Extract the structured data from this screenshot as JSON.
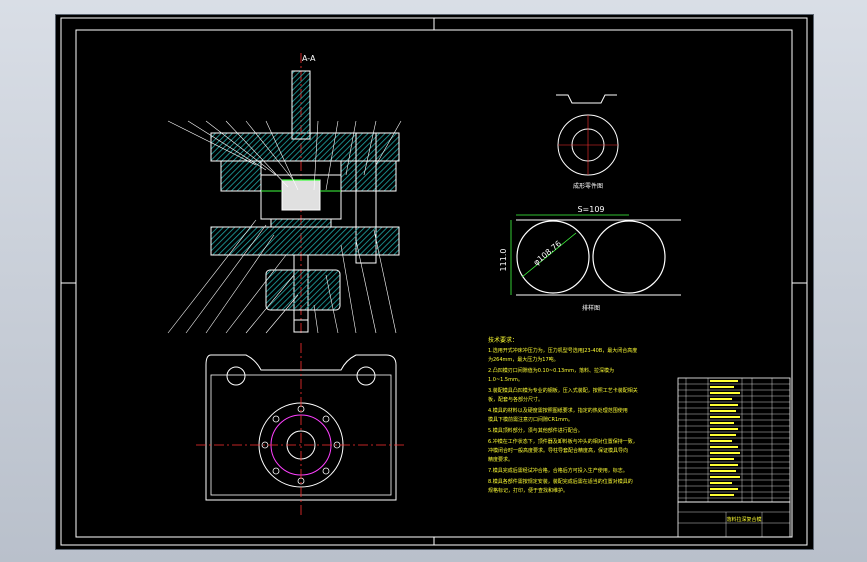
{
  "section_label": "A-A",
  "blank_view": {
    "caption": "成形零件图"
  },
  "strip_layout": {
    "pitch_label": "S=109",
    "width_label": "111.0",
    "diameter_label": "φ108.76",
    "caption": "排样图"
  },
  "technical_requirements": {
    "title": "技术要求：",
    "lines": [
      "1.选用开式冲床冲压力为，压力机型号选用J23-40B，最大闭合高度",
      "为264mm，最大压力为17吨。",
      "2.凸凹模刃口间隙值为0.10~0.13mm，落料、拉深模为",
      "1.0~1.5mm。",
      "3.装配模具凸凹模为专业的钢板，压入式装配，按照工艺卡装配相关",
      "板，配套与各部分尺寸。",
      "4.模具的材料以及硬度需按照图纸要求，指定的热处理范围使用",
      "模具下模前需注意刃口间隙CR1mm。",
      "5.模具顶料部分，须与其他部件进行配合。",
      "6.冲模在工作状态下，顶件器及卸料板与冲头的相对位置保持一致，",
      "冲模闭合时一般高度要求。导柱导套配合精度高，保证模具导向",
      "精度要求。",
      "7.模具完成后需经试冲合格，合格后方可投入生产使用，标志。",
      "8.模具各部件需按规定安装，装配完成后需在适当的位置对模具的",
      "规格标记，打印，便于查找和维护。"
    ]
  },
  "title_block": {
    "drawing_name": "落料拉深复合模"
  },
  "colors": {
    "outline": "#ffffff",
    "center_line": "#ff3030",
    "hatch": "#1fa6a6",
    "dimension": "#40ff40",
    "text_yellow": "#ffff33",
    "magenta": "#ff40ff"
  }
}
